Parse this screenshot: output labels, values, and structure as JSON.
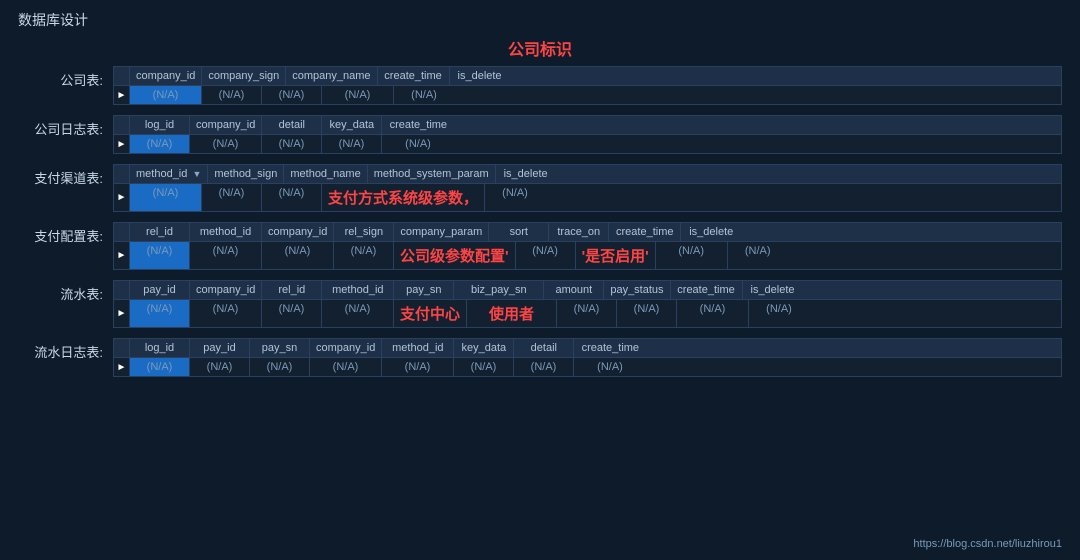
{
  "page": {
    "title": "数据库设计",
    "center_label": "公司标识",
    "footer_link": "https://blog.csdn.net/liuzhirou1"
  },
  "tables": [
    {
      "label": "公司表:",
      "columns": [
        "company_id",
        "company_sign",
        "company_name",
        "create_time",
        "is_delete"
      ],
      "data": [
        "(N/A)",
        "(N/A)",
        "(N/A)",
        "(N/A)",
        "(N/A)"
      ],
      "highlight_col": 0,
      "special_data": null
    },
    {
      "label": "公司日志表:",
      "columns": [
        "log_id",
        "company_id",
        "detail",
        "key_data",
        "create_time"
      ],
      "data": [
        "(N/A)",
        "(N/A)",
        "(N/A)",
        "(N/A)",
        "(N/A)"
      ],
      "highlight_col": 0,
      "special_data": null
    },
    {
      "label": "支付渠道表:",
      "columns": [
        "method_id",
        "method_sign",
        "method_name",
        "method_system_param",
        "is_delete"
      ],
      "data": [
        "(N/A)",
        "(N/A)",
        "(N/A)",
        "支付方式系统级参数，",
        "(N/A)"
      ],
      "highlight_col": 0,
      "has_dropdown": true,
      "special_data": [
        null,
        null,
        null,
        "red",
        null
      ]
    },
    {
      "label": "支付配置表:",
      "columns": [
        "rel_id",
        "method_id",
        "company_id",
        "rel_sign",
        "company_param",
        "sort",
        "trace_on",
        "create_time",
        "is_delete"
      ],
      "data": [
        "(N/A)",
        "(N/A)",
        "(N/A)",
        "(N/A)",
        "公司级参数配置'",
        "(N/A)",
        "'是否启用'",
        "(N/A)",
        "(N/A)"
      ],
      "highlight_col": 0,
      "special_data": [
        null,
        null,
        null,
        null,
        "red",
        null,
        "red",
        null,
        null
      ]
    },
    {
      "label": "流水表:",
      "columns": [
        "pay_id",
        "company_id",
        "rel_id",
        "method_id",
        "pay_sn",
        "biz_pay_sn",
        "amount",
        "pay_status",
        "create_time",
        "is_delete"
      ],
      "data": [
        "(N/A)",
        "(N/A)",
        "(N/A)",
        "(N/A)",
        "支付中心",
        "使用者",
        "(N/A)",
        "(N/A)",
        "(N/A)",
        "(N/A)"
      ],
      "highlight_col": 0,
      "special_data": [
        null,
        null,
        null,
        null,
        "red",
        "red",
        null,
        null,
        null,
        null
      ]
    },
    {
      "label": "流水日志表:",
      "columns": [
        "log_id",
        "pay_id",
        "pay_sn",
        "company_id",
        "method_id",
        "key_data",
        "detail",
        "create_time"
      ],
      "data": [
        "(N/A)",
        "(N/A)",
        "(N/A)",
        "(N/A)",
        "(N/A)",
        "(N/A)",
        "(N/A)",
        "(N/A)"
      ],
      "highlight_col": 0,
      "special_data": null
    }
  ]
}
